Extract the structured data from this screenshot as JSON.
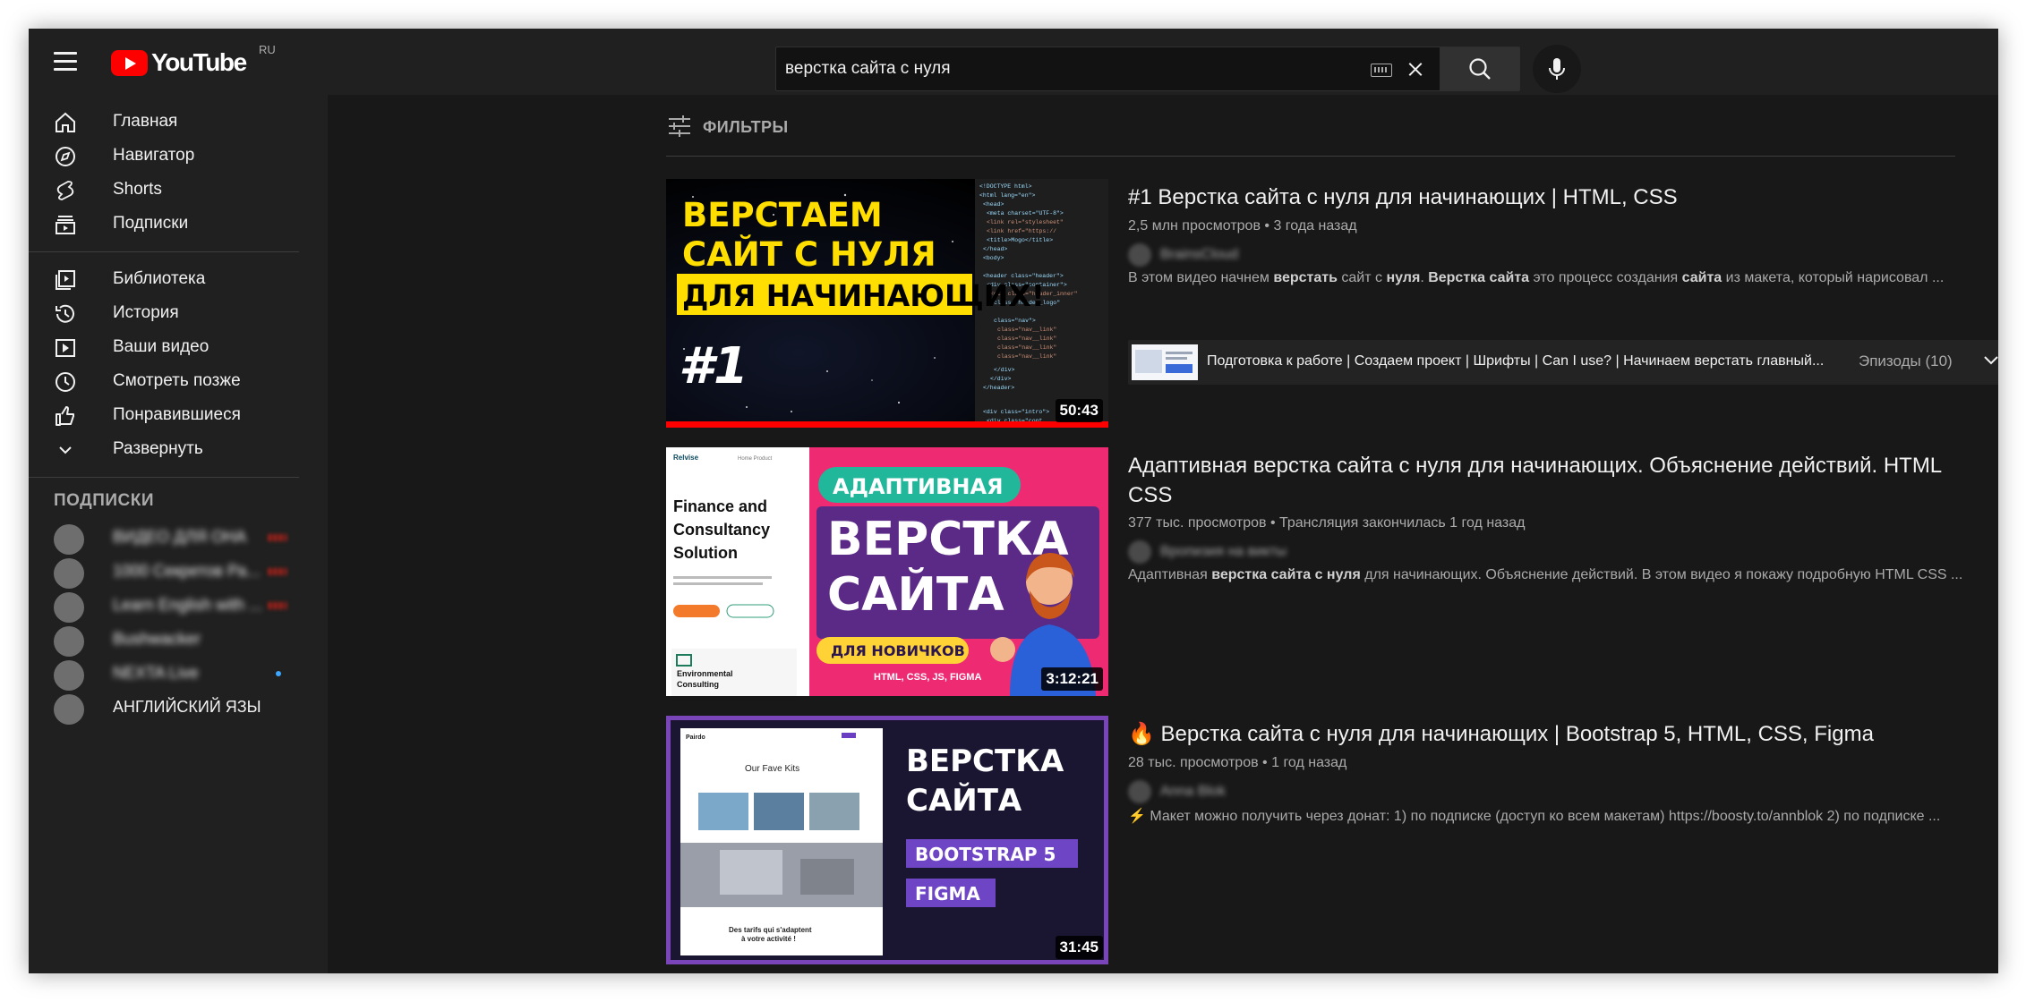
{
  "header": {
    "logo_text": "YouTube",
    "country_code": "RU",
    "search_value": "верстка сайта с нуля",
    "icons": [
      "menu-icon",
      "youtube-logo",
      "keyboard-icon",
      "close-icon",
      "search-icon",
      "mic-icon"
    ]
  },
  "sidebar": {
    "main_items": [
      {
        "label": "Главная",
        "icon": "home-icon"
      },
      {
        "label": "Навигатор",
        "icon": "compass-icon"
      },
      {
        "label": "Shorts",
        "icon": "shorts-icon"
      },
      {
        "label": "Подписки",
        "icon": "subscriptions-icon"
      }
    ],
    "library_items": [
      {
        "label": "Библиотека",
        "icon": "library-icon"
      },
      {
        "label": "История",
        "icon": "history-icon"
      },
      {
        "label": "Ваши видео",
        "icon": "your-videos-icon"
      },
      {
        "label": "Смотреть позже",
        "icon": "watch-later-icon"
      },
      {
        "label": "Понравившиеся",
        "icon": "like-icon"
      },
      {
        "label": "Развернуть",
        "icon": "chevron-down-icon"
      }
    ],
    "subscriptions_heading": "ПОДПИСКИ",
    "subscriptions": [
      {
        "name": "ВИДЕО ДЛЯ ОНА",
        "indicator": "live"
      },
      {
        "name": "1000 Секретов Ра...",
        "indicator": "live"
      },
      {
        "name": "Learn English with ...",
        "indicator": "live"
      },
      {
        "name": "Bushwacker",
        "indicator": "none"
      },
      {
        "name": "NEXTA Live",
        "indicator": "new"
      },
      {
        "name": "АНГЛИЙСКИЙ ЯЗЫ",
        "indicator": "none"
      }
    ]
  },
  "filters": {
    "label": "ФИЛЬТРЫ"
  },
  "results": [
    {
      "title": "#1 Верстка сайта с нуля для начинающих | HTML, CSS",
      "views": "2,5 млн просмотров",
      "age": "3 года назад",
      "channel": "BrainsCloud",
      "description_html": "В этом видео начнем <b>верстать</b> сайт с <b>нуля</b>. <b>Верстка сайта</b> это процесс создания <b>сайта</b> из макета, который нарисовал ...",
      "duration": "50:43",
      "chapters_text": "Подготовка к работе | Создаем проект | Шрифты | Can I use? | Начинаем верстать главный...",
      "chapters_count": "Эпизоды (10)",
      "thumb_lines": [
        "ВЕРСТАЕМ",
        "САЙТ С НУЛЯ",
        "ДЛЯ НАЧИНАЮЩИХ!",
        "#1"
      ]
    },
    {
      "title": "Адаптивная верстка сайта с нуля для начинающих. Объяснение действий. HTML CSS",
      "views": "377 тыс. просмотров",
      "age": "Трансляция закончилась 1 год назад",
      "channel": "Вропизия на викты",
      "description_html": "Адаптивная <b>верстка сайта с нуля</b> для начинающих. Объяснение действий. В этом видео я покажу подробную HTML CSS ...",
      "duration": "3:12:21",
      "thumb_lines": [
        "АДАПТИВНАЯ",
        "ВЕРСТКА",
        "САЙТА",
        "ДЛЯ НОВИЧКОВ",
        "HTML, CSS, JS, FIGMA",
        "Finance and Consultancy Solution",
        "Relvise",
        "Environmental Consulting"
      ]
    },
    {
      "title": "🔥 Верстка сайта с нуля для начинающих | Bootstrap 5, HTML, CSS, Figma",
      "views": "28 тыс. просмотров",
      "age": "1 год назад",
      "channel": "Anna Blok",
      "description_html": "⚡ Макет можно получить через донат: 1) по подписке (доступ ко всем макетам) https://boosty.to/annblok 2) по подписке ...",
      "duration": "31:45",
      "thumb_lines": [
        "ВЕРСТКА",
        "САЙТА",
        "BOOTSTRAP 5",
        "FIGMA",
        "Our Fave Kits",
        "Des tarifs qui s'adaptent à votre activité !",
        "Pairdo"
      ]
    }
  ],
  "colors": {
    "bg": "#181818",
    "surface": "#202020",
    "accent_red": "#ff0000",
    "text_primary": "#f1f1f1",
    "text_secondary": "#aaaaaa"
  }
}
